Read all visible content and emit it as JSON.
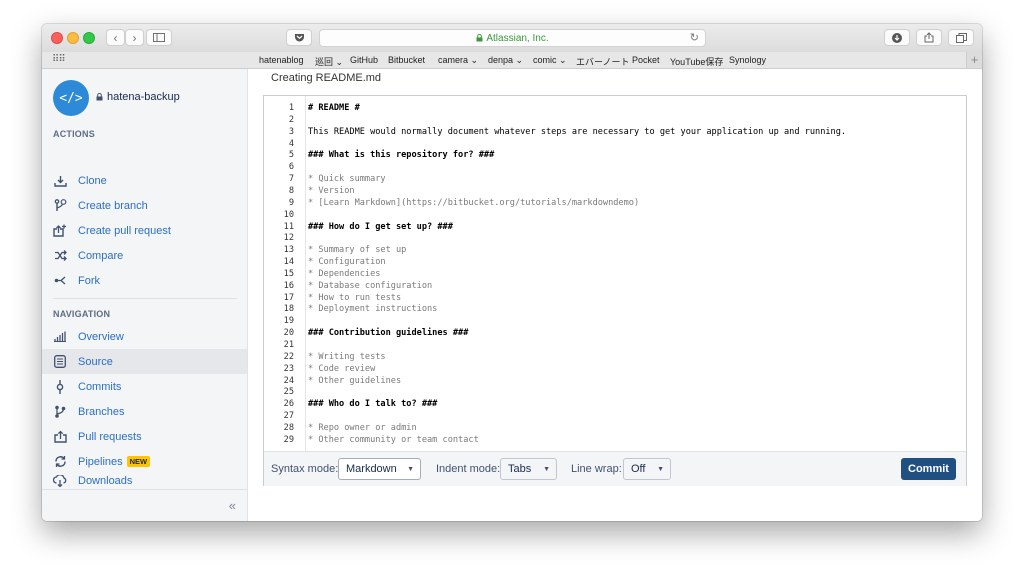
{
  "browser": {
    "url_text": "Atlassian, Inc.",
    "bookmarks": [
      "hatenablog",
      "巡回 ⌄",
      "GitHub",
      "Bitbucket",
      "camera ⌄",
      "denpa ⌄",
      "comic ⌄",
      "エバーノート",
      "Pocket",
      "YouTube保存",
      "Synology"
    ]
  },
  "sidebar": {
    "repo_name": "hatena-backup",
    "actions_heading": "ACTIONS",
    "actions": [
      {
        "label": "Clone",
        "icon": "download-icon"
      },
      {
        "label": "Create branch",
        "icon": "create-branch-icon"
      },
      {
        "label": "Create pull request",
        "icon": "create-pull-request-icon"
      },
      {
        "label": "Compare",
        "icon": "compare-icon"
      },
      {
        "label": "Fork",
        "icon": "fork-icon"
      }
    ],
    "navigation_heading": "NAVIGATION",
    "navigation": [
      {
        "label": "Overview",
        "icon": "overview-icon"
      },
      {
        "label": "Source",
        "icon": "source-icon"
      },
      {
        "label": "Commits",
        "icon": "commits-icon"
      },
      {
        "label": "Branches",
        "icon": "branches-icon"
      },
      {
        "label": "Pull requests",
        "icon": "pull-requests-icon"
      },
      {
        "label": "Pipelines",
        "icon": "pipelines-icon",
        "badge": "NEW"
      },
      {
        "label": "Downloads",
        "icon": "downloads-icon"
      }
    ],
    "collapse_label": "«"
  },
  "main": {
    "title": "Creating README.md",
    "editor_lines": [
      {
        "n": "1",
        "text": "# README #",
        "style": "h"
      },
      {
        "n": "2",
        "text": "",
        "style": ""
      },
      {
        "n": "3",
        "text": "This README would normally document whatever steps are necessary to get your application up and running.",
        "style": ""
      },
      {
        "n": "4",
        "text": "",
        "style": ""
      },
      {
        "n": "5",
        "text": "### What is this repository for? ###",
        "style": "h"
      },
      {
        "n": "6",
        "text": "",
        "style": ""
      },
      {
        "n": "7",
        "text": "* Quick summary",
        "style": "l"
      },
      {
        "n": "8",
        "text": "* Version",
        "style": "l"
      },
      {
        "n": "9",
        "text": "* [Learn Markdown](https://bitbucket.org/tutorials/markdowndemo)",
        "style": "l"
      },
      {
        "n": "10",
        "text": "",
        "style": ""
      },
      {
        "n": "11",
        "text": "### How do I get set up? ###",
        "style": "h"
      },
      {
        "n": "12",
        "text": "",
        "style": ""
      },
      {
        "n": "13",
        "text": "* Summary of set up",
        "style": "l"
      },
      {
        "n": "14",
        "text": "* Configuration",
        "style": "l"
      },
      {
        "n": "15",
        "text": "* Dependencies",
        "style": "l"
      },
      {
        "n": "16",
        "text": "* Database configuration",
        "style": "l"
      },
      {
        "n": "17",
        "text": "* How to run tests",
        "style": "l"
      },
      {
        "n": "18",
        "text": "* Deployment instructions",
        "style": "l"
      },
      {
        "n": "19",
        "text": "",
        "style": ""
      },
      {
        "n": "20",
        "text": "### Contribution guidelines ###",
        "style": "h"
      },
      {
        "n": "21",
        "text": "",
        "style": ""
      },
      {
        "n": "22",
        "text": "* Writing tests",
        "style": "l"
      },
      {
        "n": "23",
        "text": "* Code review",
        "style": "l"
      },
      {
        "n": "24",
        "text": "* Other guidelines",
        "style": "l"
      },
      {
        "n": "25",
        "text": "",
        "style": ""
      },
      {
        "n": "26",
        "text": "### Who do I talk to? ###",
        "style": "h"
      },
      {
        "n": "27",
        "text": "",
        "style": ""
      },
      {
        "n": "28",
        "text": "* Repo owner or admin",
        "style": "l"
      },
      {
        "n": "29",
        "text": "* Other community or team contact",
        "style": "l"
      }
    ],
    "footer": {
      "syntax_label": "Syntax mode:",
      "syntax_value": "Markdown",
      "indent_label": "Indent mode:",
      "indent_value": "Tabs",
      "wrap_label": "Line wrap:",
      "wrap_value": "Off",
      "commit_label": "Commit"
    }
  },
  "colors": {
    "accent": "#2b6fc4",
    "commit_button": "#205081",
    "badge": "#ffc400",
    "avatar": "#2d8ad8"
  }
}
